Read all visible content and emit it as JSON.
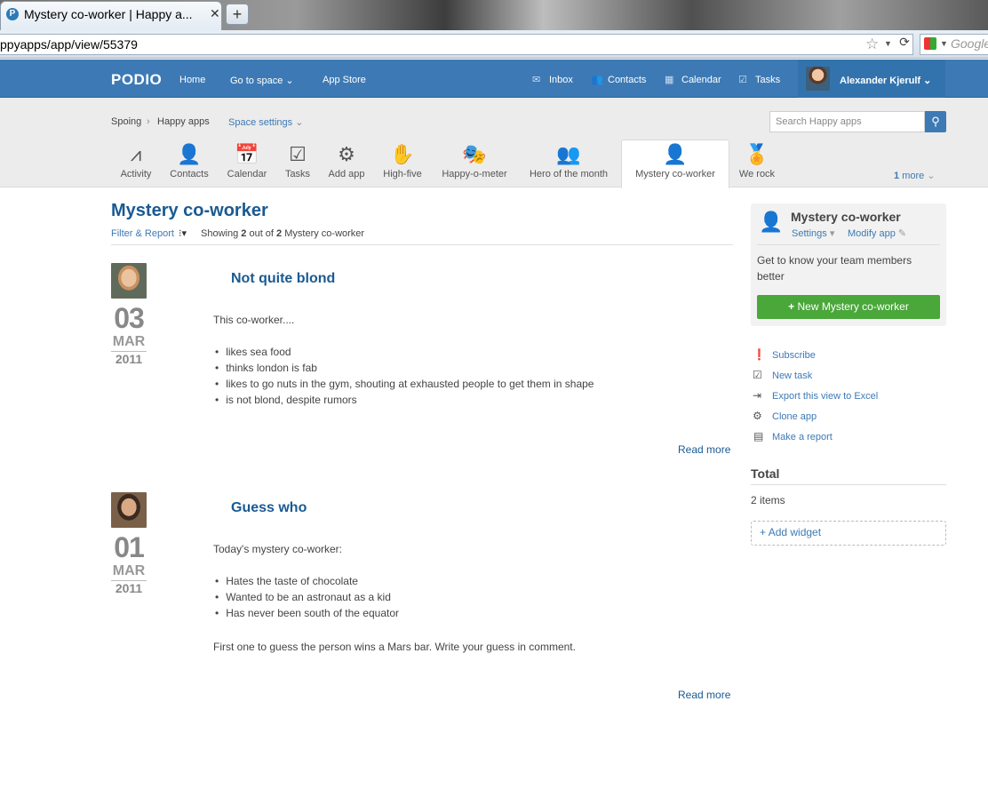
{
  "browser": {
    "tab_title": "Mystery co-worker | Happy a...",
    "tab_favicon": "P",
    "close_glyph": "✕",
    "newtab_glyph": "+",
    "url": "ppyapps/app/view/55379",
    "search_engine_placeholder": "Google"
  },
  "header": {
    "logo": "PODIO",
    "nav": [
      "Home",
      "Go to space",
      "App Store"
    ],
    "right_nav": [
      "Inbox",
      "Contacts",
      "Calendar",
      "Tasks"
    ],
    "user_name": "Alexander Kjerulf"
  },
  "space": {
    "breadcrumb_org": "Spoing",
    "breadcrumb_space": "Happy apps",
    "settings": "Space settings",
    "search_placeholder": "Search Happy apps",
    "apps": [
      "Activity",
      "Contacts",
      "Calendar",
      "Tasks",
      "Add app",
      "High-five",
      "Happy-o-meter",
      "Hero of the month",
      "Mystery co-worker",
      "We rock"
    ],
    "more_count": "1",
    "more_label": "more"
  },
  "main": {
    "title": "Mystery co-worker",
    "filter_label": "Filter & Report",
    "showing_prefix": "Showing",
    "showing_count": "2",
    "showing_mid": "out of",
    "showing_total": "2",
    "showing_suffix": "Mystery co-worker",
    "read_more": "Read more",
    "items": [
      {
        "title": "Not quite blond",
        "day": "03",
        "month": "MAR",
        "year": "2011",
        "intro": "This co-worker....",
        "bullets": [
          "likes sea food",
          "thinks london is fab",
          "likes to go nuts in the gym, shouting at exhausted people to get them in shape",
          "is not blond, despite rumors"
        ],
        "outro": ""
      },
      {
        "title": "Guess who",
        "day": "01",
        "month": "MAR",
        "year": "2011",
        "intro": "Today's mystery co-worker:",
        "bullets": [
          "Hates the taste of chocolate",
          "Wanted to be an astronaut as a kid",
          "Has never been south of the equator"
        ],
        "outro": "First one to guess the person wins a Mars bar. Write your guess in comment."
      }
    ]
  },
  "sidebar": {
    "app_title": "Mystery co-worker",
    "settings": "Settings",
    "modify": "Modify app",
    "description": "Get to know your team members better",
    "new_button": "New Mystery co-worker",
    "actions": [
      "Subscribe",
      "New task",
      "Export this view to Excel",
      "Clone app",
      "Make a report"
    ],
    "total_heading": "Total",
    "total_value": "2 items",
    "add_widget": "Add widget"
  },
  "colors": {
    "brand": "#3d7ab5",
    "title": "#1a5a92",
    "button": "#4aa73a"
  }
}
